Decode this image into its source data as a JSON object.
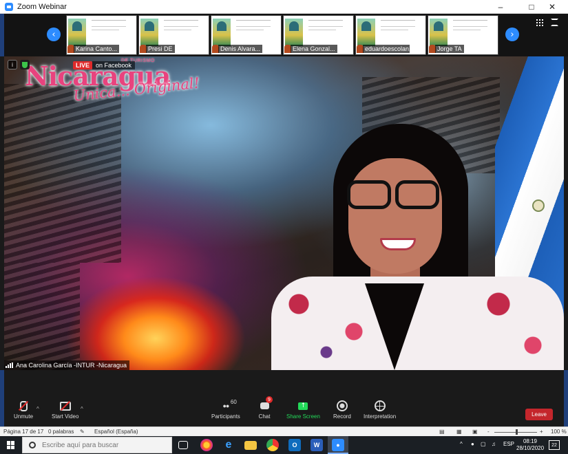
{
  "window": {
    "title": "Zoom Webinar"
  },
  "gallery": {
    "prev_arrow": "‹",
    "next_arrow": "›",
    "participants": [
      {
        "name": "Karina Canto..."
      },
      {
        "name": "Presi DE"
      },
      {
        "name": "Denis Alvara..."
      },
      {
        "name": "Elena Gonzal..."
      },
      {
        "name": "eduardoescolan..."
      },
      {
        "name": "Jorge TA"
      }
    ]
  },
  "video": {
    "logo_title": "Nicaragua",
    "logo_tagline": "Única... Original!",
    "logo_small": "DE TURISMO",
    "live_badge": "LIVE",
    "live_text": "on Facebook",
    "info_glyph": "i",
    "speaker_name": "Ana Carolina García -INTUR -Nicaragua"
  },
  "controls": {
    "unmute": "Unmute",
    "start_video": "Start Video",
    "participants": "Participants",
    "participants_count": "60",
    "chat": "Chat",
    "chat_badge": "9",
    "share_screen": "Share Screen",
    "record": "Record",
    "interpretation": "Interpretation",
    "leave": "Leave",
    "share_color": "#23d959",
    "leave_color": "#c4262c"
  },
  "word_status": {
    "page": "Página 17 de 17",
    "words": "0 palabras",
    "language": "Español (España)",
    "zoom": "100 %",
    "minus": "-",
    "plus": "+"
  },
  "taskbar": {
    "search_placeholder": "Escribe aquí para buscar",
    "lang": "ESP",
    "time": "08:19",
    "date": "28/10/2020",
    "notifications": "22"
  }
}
